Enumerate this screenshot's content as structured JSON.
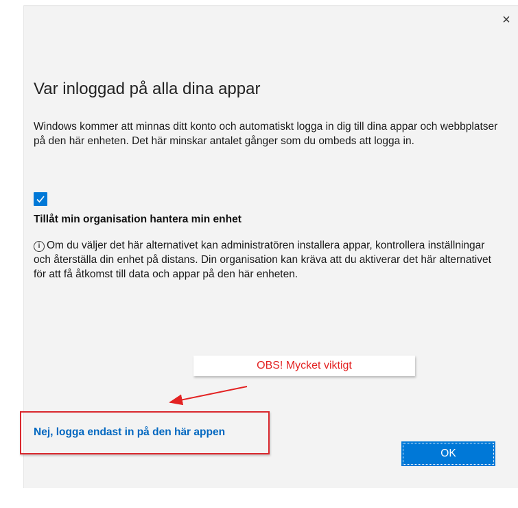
{
  "dialog": {
    "title": "Var inloggad på alla dina appar",
    "description": "Windows kommer att minnas ditt konto och automatiskt logga in dig till dina appar och webbplatser på den här enheten. Det här minskar antalet gånger som du ombeds att logga in.",
    "checkbox": {
      "checked": true,
      "label": "Tillåt min organisation hantera min enhet"
    },
    "info_text": "Om du väljer det här alternativet kan administratören installera appar, kontrollera inställningar och återställa din enhet på distans. Din organisation kan kräva att du aktiverar det här alternativet för att få åtkomst till data och appar på den här enheten.",
    "link_label": "Nej, logga endast in på den här appen",
    "ok_label": "OK",
    "close_glyph": "×"
  },
  "annotation": {
    "callout_text": "OBS! Mycket viktigt",
    "color": "#d9272d"
  },
  "colors": {
    "accent": "#0078d7",
    "link": "#0067c0",
    "dialog_bg": "#f3f3f3"
  }
}
